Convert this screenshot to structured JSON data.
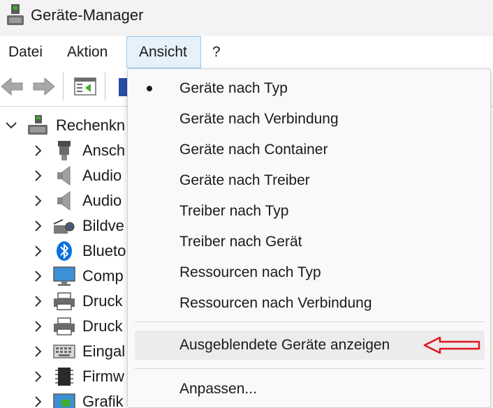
{
  "window": {
    "title": "Geräte-Manager"
  },
  "menubar": [
    {
      "label": "Datei"
    },
    {
      "label": "Aktion"
    },
    {
      "label": "Ansicht"
    },
    {
      "label": "?"
    }
  ],
  "tree": {
    "root": {
      "label": "Rechenkn"
    },
    "children": [
      {
        "label": "Ansch",
        "icon": "connector-icon"
      },
      {
        "label": "Audio",
        "icon": "speaker-icon"
      },
      {
        "label": "Audio",
        "icon": "speaker-icon"
      },
      {
        "label": "Bildve",
        "icon": "camera-icon"
      },
      {
        "label": "Blueto",
        "icon": "bluetooth-icon"
      },
      {
        "label": "Comp",
        "icon": "monitor-icon"
      },
      {
        "label": "Druck",
        "icon": "printer-icon"
      },
      {
        "label": "Druck",
        "icon": "printer-icon"
      },
      {
        "label": "Eingal",
        "icon": "keyboard-icon"
      },
      {
        "label": "Firmw",
        "icon": "chip-icon"
      },
      {
        "label": "Grafik",
        "icon": "graphics-card-icon"
      }
    ]
  },
  "dropdown": {
    "items": [
      {
        "label": "Geräte nach Typ",
        "checked": true
      },
      {
        "label": "Geräte nach Verbindung",
        "checked": false
      },
      {
        "label": "Geräte nach Container",
        "checked": false
      },
      {
        "label": "Geräte nach Treiber",
        "checked": false
      },
      {
        "label": "Treiber nach Typ",
        "checked": false
      },
      {
        "label": "Treiber nach Gerät",
        "checked": false
      },
      {
        "label": "Ressourcen nach Typ",
        "checked": false
      },
      {
        "label": "Ressourcen nach Verbindung",
        "checked": false
      }
    ],
    "highlighted": {
      "label": "Ausgeblendete Geräte anzeigen"
    },
    "footer": {
      "label": "Anpassen..."
    }
  },
  "colors": {
    "active_menu_bg": "#e5f1fb",
    "active_menu_border": "#99c9ef",
    "annotation_arrow": "#e0141e",
    "bluetooth_blue": "#0a6fe0"
  }
}
